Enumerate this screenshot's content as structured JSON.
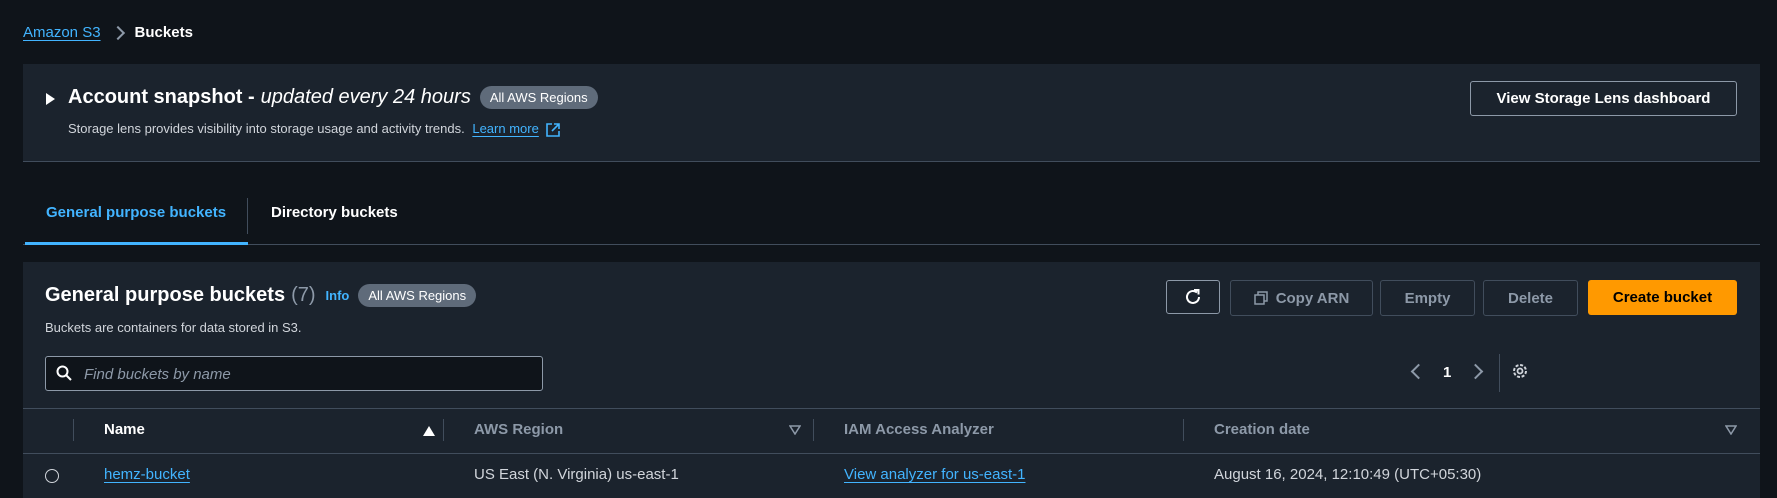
{
  "breadcrumb": {
    "root": "Amazon S3",
    "current": "Buckets"
  },
  "snapshot": {
    "title": "Account snapshot -",
    "title_em": "updated every 24 hours",
    "badge": "All AWS Regions",
    "description": "Storage lens provides visibility into storage usage and activity trends.",
    "learn_more": "Learn more",
    "lens_button": "View Storage Lens dashboard"
  },
  "tabs": [
    {
      "label": "General purpose buckets",
      "active": true
    },
    {
      "label": "Directory buckets",
      "active": false
    }
  ],
  "panel": {
    "title": "General purpose buckets",
    "count": "(7)",
    "info": "Info",
    "badge": "All AWS Regions",
    "description": "Buckets are containers for data stored in S3.",
    "copy_arn": "Copy ARN",
    "empty": "Empty",
    "delete": "Delete",
    "create": "Create bucket",
    "search_placeholder": "Find buckets by name",
    "page": "1"
  },
  "table": {
    "columns": [
      "Name",
      "AWS Region",
      "IAM Access Analyzer",
      "Creation date"
    ],
    "rows": [
      {
        "name": "hemz-bucket",
        "region": "US East (N. Virginia) us-east-1",
        "iam": "View analyzer for us-east-1",
        "created": "August 16, 2024, 12:10:49 (UTC+05:30)"
      }
    ]
  },
  "colors": {
    "accent": "#42b4ff",
    "primary_button": "#ff9900",
    "background": "#0f141a",
    "panel": "#1b232d"
  }
}
